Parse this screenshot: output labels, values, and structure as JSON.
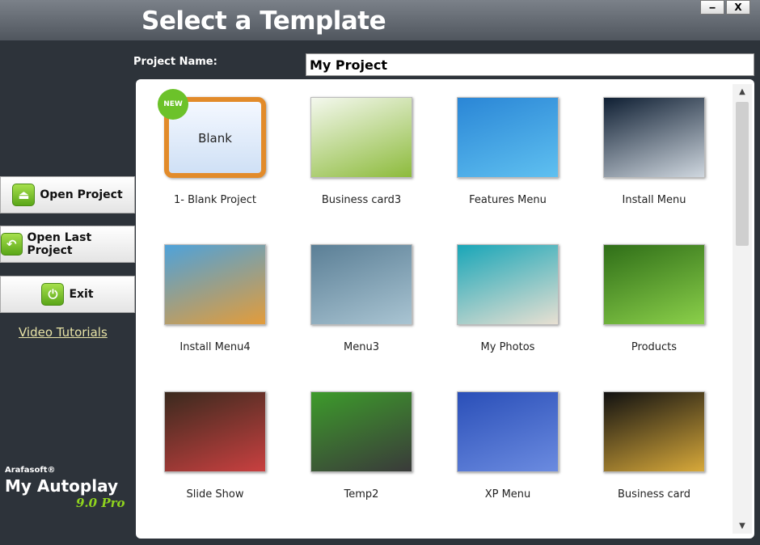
{
  "window": {
    "title": "Select a Template",
    "minimize_label": "‒",
    "close_label": "X"
  },
  "project": {
    "label": "Project Name:",
    "value": "My Project"
  },
  "sidebar": {
    "buttons": [
      {
        "label": "Open Project",
        "icon": "eject-icon",
        "glyph": "⏏"
      },
      {
        "label": "Open Last Project",
        "icon": "undo-icon",
        "glyph": "↶"
      },
      {
        "label": "Exit",
        "icon": "power-icon",
        "glyph": "⏻"
      }
    ],
    "video_link": "Video Tutorials"
  },
  "logo": {
    "brand": "Arafasoft®",
    "product": "My Autoplay",
    "version": "9.0 Pro"
  },
  "templates": [
    {
      "label": "1- Blank Project",
      "thumb_text": "Blank",
      "badge": "NEW",
      "colors": [
        "#d9e7f7",
        "#3f74c2"
      ]
    },
    {
      "label": "Business card3",
      "colors": [
        "#f4f8ee",
        "#8dbb3c"
      ]
    },
    {
      "label": "Features Menu",
      "colors": [
        "#2a86d6",
        "#5fc0f0"
      ]
    },
    {
      "label": "Install Menu",
      "colors": [
        "#0f1f33",
        "#cfd7df"
      ]
    },
    {
      "label": "Install Menu4",
      "colors": [
        "#4ea2da",
        "#e39c3a"
      ]
    },
    {
      "label": "Menu3",
      "colors": [
        "#5b7f96",
        "#a9c4d2"
      ]
    },
    {
      "label": "My Photos",
      "colors": [
        "#19a6b8",
        "#e8e0d2"
      ]
    },
    {
      "label": "Products",
      "colors": [
        "#2f6e18",
        "#8bd04a"
      ]
    },
    {
      "label": "Slide Show",
      "colors": [
        "#3a2a1e",
        "#c94040"
      ]
    },
    {
      "label": "Temp2",
      "colors": [
        "#3d9b2b",
        "#3a3a3a"
      ]
    },
    {
      "label": "XP Menu",
      "colors": [
        "#2a4fb8",
        "#6b8be0"
      ]
    },
    {
      "label": "Business card",
      "colors": [
        "#111111",
        "#d8a93a"
      ]
    }
  ],
  "colors": {
    "accent": "#7cc52c",
    "link": "#e8e3a6",
    "background": "#2d333a"
  }
}
